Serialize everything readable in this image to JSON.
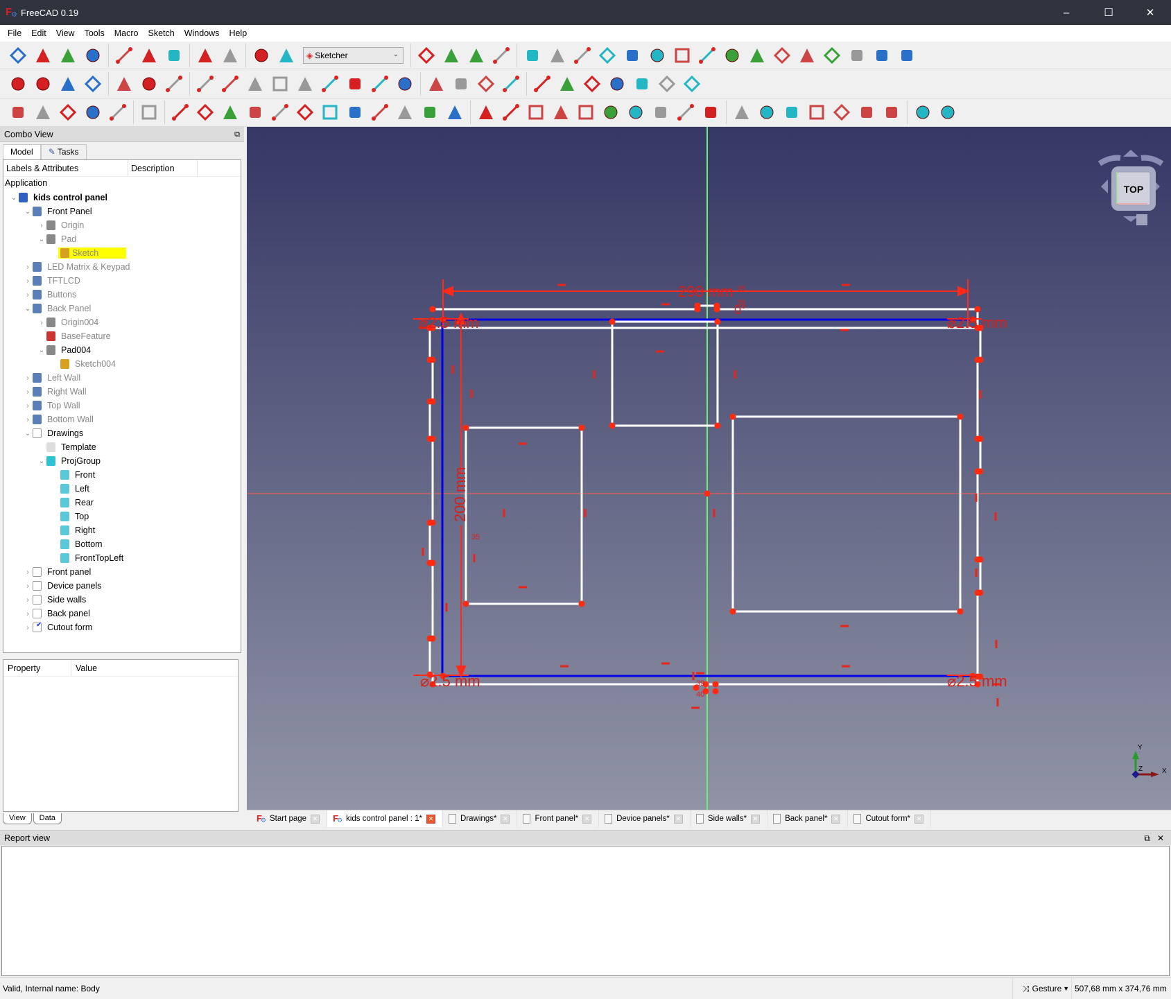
{
  "window": {
    "title": "FreeCAD 0.19",
    "controls": {
      "minimize": "–",
      "maximize": "☐",
      "close": "✕"
    }
  },
  "menubar": [
    "File",
    "Edit",
    "View",
    "Tools",
    "Macro",
    "Sketch",
    "Windows",
    "Help"
  ],
  "toolbar": {
    "workbench_selector": "Sketcher",
    "row1_icons": [
      "new-document-icon",
      "open-icon",
      "save-icon",
      "save-as-icon",
      "cut-icon",
      "copy-icon",
      "paste-icon",
      "undo-icon",
      "redo-icon",
      "refresh-icon",
      "whats-this-icon",
      "macro-record-icon",
      "macro-stop-icon",
      "macro-edit-icon",
      "macro-run-icon",
      "point-icon",
      "line-icon",
      "arc-icon",
      "circle-icon",
      "conic-icon",
      "bspline-icon",
      "polyline-icon",
      "rectangle-icon",
      "polygon-icon",
      "slot-icon",
      "fillet-icon",
      "trim-icon",
      "extend-icon",
      "external-geometry-icon",
      "carbon-copy-icon",
      "construction-mode-icon"
    ],
    "row2_icons": [
      "fit-all-icon",
      "fit-selection-icon",
      "draw-style-icon",
      "bounding-box-icon",
      "back-icon",
      "forward-icon",
      "std-views-icon",
      "sync-view-icon",
      "isometric-icon",
      "front-view-icon",
      "top-view-icon",
      "right-view-icon",
      "rear-view-icon",
      "bottom-view-icon",
      "left-view-icon",
      "measure-icon",
      "new-sketch-icon",
      "edit-sketch-icon",
      "leave-sketch-icon",
      "reorient-sketch-icon",
      "validate-sketch-icon",
      "map-sketch-icon",
      "merge-sketch-icon",
      "mirror-sketch-icon",
      "view-sketch-icon",
      "view-section-icon",
      "close-sketch-icon"
    ],
    "row3_icons": [
      "sketcher-geometry-icon",
      "restore-internal-icon",
      "select-constraints-icon",
      "select-origin-icon",
      "select-elements-icon",
      "toggle-driving-icon",
      "dof-icon",
      "select-conflicting-icon",
      "select-redundant-icon",
      "select-horizontal-icon",
      "select-vertical-icon",
      "show-hide-internal-icon",
      "symmetry-icon",
      "clone-icon",
      "copy-geom-icon",
      "rect-array-icon",
      "remove-axes-icon",
      "delete-all-constraints-icon",
      "coincident-icon",
      "point-on-object-icon",
      "vertical-icon",
      "horizontal-icon",
      "parallel-icon",
      "perpendicular-icon",
      "tangent-icon",
      "equal-icon",
      "symmetric-icon",
      "block-icon",
      "lock-icon",
      "horizontal-distance-icon",
      "vertical-distance-icon",
      "distance-icon",
      "radius-icon",
      "angle-icon",
      "snell-icon",
      "toggle-construction-icon",
      "toggle-active-icon"
    ]
  },
  "combo_view": {
    "title": "Combo View",
    "tabs": [
      "Model",
      "Tasks"
    ],
    "tree_columns": [
      "Labels & Attributes",
      "Description"
    ],
    "application_label": "Application",
    "tree": [
      {
        "label": "kids control panel",
        "depth": 0,
        "expanded": true,
        "bold": true,
        "icon": "document-icon"
      },
      {
        "label": "Front Panel",
        "depth": 1,
        "expanded": true,
        "icon": "body-icon"
      },
      {
        "label": "Origin",
        "depth": 2,
        "collapsed": true,
        "dim": true,
        "icon": "origin-icon"
      },
      {
        "label": "Pad",
        "depth": 2,
        "expanded": true,
        "dim": true,
        "icon": "pad-icon"
      },
      {
        "label": "Sketch",
        "depth": 3,
        "dim": true,
        "highlighted": true,
        "icon": "sketch-icon"
      },
      {
        "label": "LED Matrix & Keypad",
        "depth": 1,
        "collapsed": true,
        "dim": true,
        "icon": "body-icon"
      },
      {
        "label": "TFTLCD",
        "depth": 1,
        "collapsed": true,
        "dim": true,
        "icon": "body-icon"
      },
      {
        "label": "Buttons",
        "depth": 1,
        "collapsed": true,
        "dim": true,
        "icon": "body-icon"
      },
      {
        "label": "Back Panel",
        "depth": 1,
        "expanded": true,
        "dim": true,
        "icon": "body-icon"
      },
      {
        "label": "Origin004",
        "depth": 2,
        "collapsed": true,
        "dim": true,
        "icon": "origin-icon"
      },
      {
        "label": "BaseFeature",
        "depth": 2,
        "dim": true,
        "icon": "base-feature-icon"
      },
      {
        "label": "Pad004",
        "depth": 2,
        "expanded": true,
        "icon": "pad-icon"
      },
      {
        "label": "Sketch004",
        "depth": 3,
        "dim": true,
        "icon": "sketch-icon"
      },
      {
        "label": "Left Wall",
        "depth": 1,
        "collapsed": true,
        "dim": true,
        "icon": "body-icon"
      },
      {
        "label": "Right Wall",
        "depth": 1,
        "collapsed": true,
        "dim": true,
        "icon": "body-icon"
      },
      {
        "label": "Top Wall",
        "depth": 1,
        "collapsed": true,
        "dim": true,
        "icon": "body-icon"
      },
      {
        "label": "Bottom Wall",
        "depth": 1,
        "collapsed": true,
        "dim": true,
        "icon": "body-icon"
      },
      {
        "label": "Drawings",
        "depth": 1,
        "expanded": true,
        "icon": "page-icon"
      },
      {
        "label": "Template",
        "depth": 2,
        "icon": "template-icon"
      },
      {
        "label": "ProjGroup",
        "depth": 2,
        "expanded": true,
        "icon": "projgroup-icon"
      },
      {
        "label": "Front",
        "depth": 3,
        "icon": "view-icon"
      },
      {
        "label": "Left",
        "depth": 3,
        "icon": "view-icon"
      },
      {
        "label": "Rear",
        "depth": 3,
        "icon": "view-icon"
      },
      {
        "label": "Top",
        "depth": 3,
        "icon": "view-icon"
      },
      {
        "label": "Right",
        "depth": 3,
        "icon": "view-icon"
      },
      {
        "label": "Bottom",
        "depth": 3,
        "icon": "view-icon"
      },
      {
        "label": "FrontTopLeft",
        "depth": 3,
        "icon": "view-icon"
      },
      {
        "label": "Front panel",
        "depth": 1,
        "collapsed": true,
        "icon": "page-icon"
      },
      {
        "label": "Device panels",
        "depth": 1,
        "collapsed": true,
        "icon": "page-icon"
      },
      {
        "label": "Side walls",
        "depth": 1,
        "collapsed": true,
        "icon": "page-icon"
      },
      {
        "label": "Back panel",
        "depth": 1,
        "collapsed": true,
        "icon": "page-icon"
      },
      {
        "label": "Cutout form",
        "depth": 1,
        "collapsed": true,
        "icon": "page-checked-icon"
      }
    ],
    "property_columns": [
      "Property",
      "Value"
    ],
    "bottom_tabs": [
      "View",
      "Data"
    ]
  },
  "viewport": {
    "navcube_face": "TOP",
    "dimensions": {
      "width_label": "290 mm",
      "height_label": "200 mm",
      "diameter_tl": "⌀2.5 mm",
      "diameter_tr": "⌀2.5 mm",
      "diameter_bl": "⌀2.5 mm",
      "diameter_br": "⌀2.5 mm",
      "angle_label": "0°",
      "small_labels": [
        "35",
        "39",
        "40",
        "35",
        "39",
        "40"
      ]
    },
    "axis_labels": {
      "x": "X",
      "y": "Y",
      "z": "Z"
    }
  },
  "document_tabs": [
    {
      "label": "Start page",
      "icon": "freecad-icon"
    },
    {
      "label": "kids control panel : 1*",
      "icon": "freecad-icon",
      "active": true
    },
    {
      "label": "Drawings*",
      "icon": "page-icon"
    },
    {
      "label": "Front panel*",
      "icon": "page-icon"
    },
    {
      "label": "Device panels*",
      "icon": "page-icon"
    },
    {
      "label": "Side walls*",
      "icon": "page-icon"
    },
    {
      "label": "Back panel*",
      "icon": "page-icon"
    },
    {
      "label": "Cutout form*",
      "icon": "page-icon"
    }
  ],
  "report_view": {
    "title": "Report view"
  },
  "statusbar": {
    "message": "Valid, Internal name: Body",
    "navigation_style": "Gesture",
    "dimensions": "507,68 mm x 374,76 mm"
  }
}
